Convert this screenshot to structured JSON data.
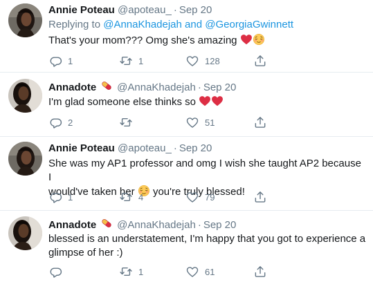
{
  "tweets": [
    {
      "name": "Annie Poteau",
      "handle": "@apoteau_",
      "separator": "·",
      "date": "Sep 20",
      "reply_prefix": "Replying to",
      "reply_to_1": "@AnnaKhadejah",
      "reply_and": "and",
      "reply_to_2": "@GeorgiaGwinnett",
      "text": "That's your mom??? Omg she's amazing",
      "replies": "1",
      "retweets": "1",
      "likes": "128"
    },
    {
      "name": "Annadote",
      "handle": "@AnnaKhadejah",
      "separator": "·",
      "date": "Sep 20",
      "text": "I'm glad someone else thinks so",
      "replies": "2",
      "retweets": "",
      "likes": "51"
    },
    {
      "name": "Annie Poteau",
      "handle": "@apoteau_",
      "separator": "·",
      "date": "Sep 20",
      "text_line1": "She was my AP1 professor and omg I wish she taught AP2 because I",
      "text_line2a": "would've taken her",
      "text_line2b": "you're truly blessed!",
      "replies": "1",
      "retweets": "4",
      "likes": "79"
    },
    {
      "name": "Annadote",
      "handle": "@AnnaKhadejah",
      "separator": "·",
      "date": "Sep 20",
      "text_line1": "blessed is an understatement, I'm happy that you got to experience a",
      "text_line2": "glimpse of her :)",
      "replies": "",
      "retweets": "1",
      "likes": "61"
    }
  ],
  "icons": {
    "reply": "reply-icon",
    "retweet": "retweet-icon",
    "like": "heart-icon",
    "share": "share-icon",
    "pill": "pill-emoji",
    "heart": "red-heart-emoji",
    "relieved": "relieved-face-emoji"
  },
  "colors": {
    "text": "#14171a",
    "secondary": "#657786",
    "link": "#1b95e0",
    "divider": "#e6ecf0",
    "heart_red": "#dd2e44"
  }
}
